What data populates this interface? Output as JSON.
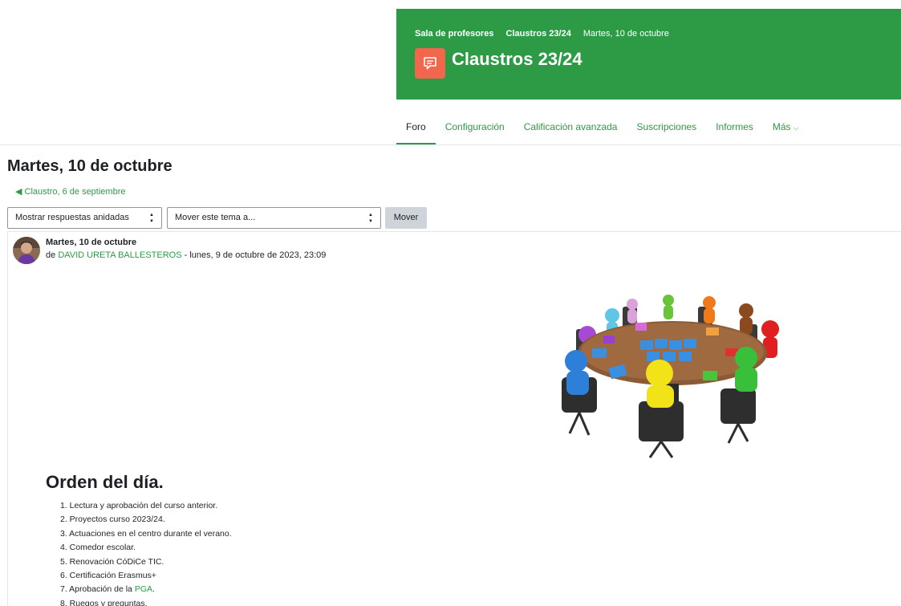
{
  "header": {
    "breadcrumbs": [
      "Sala de profesores",
      "Claustros 23/24",
      "Martes, 10 de octubre"
    ],
    "title": "Claustros 23/24",
    "icon": "forum-icon",
    "accent_color": "#2d9a46",
    "icon_color": "#f0674d"
  },
  "tabs": [
    {
      "label": "Foro",
      "active": true
    },
    {
      "label": "Configuración",
      "active": false
    },
    {
      "label": "Calificación avanzada",
      "active": false
    },
    {
      "label": "Suscripciones",
      "active": false
    },
    {
      "label": "Informes",
      "active": false
    },
    {
      "label": "Más",
      "active": false
    }
  ],
  "discussion": {
    "title": "Martes, 10 de octubre",
    "prev_link": "Claustro, 6 de septiembre",
    "display_mode": "Mostrar respuestas anidadas",
    "move_placeholder": "Mover este tema a...",
    "move_button": "Mover"
  },
  "post": {
    "subject": "Martes, 10 de octubre",
    "by_prefix": "de",
    "author": "DAVID URETA BALLESTEROS",
    "date": " - lunes, 9 de octubre de 2023, 23:09",
    "heading": "Orden del día.",
    "agenda": [
      "1. Lectura y aprobación del curso anterior.",
      "2. Proyectos curso 2023/24.",
      "3. Actuaciones en el centro durante el verano.",
      "4. Comedor escolar.",
      "5. Renovación CóDiCe TIC.",
      "6. Certificación Erasmus+",
      "7. Aprobación de la ",
      "8. Ruegos y preguntas."
    ],
    "agenda_link": "PGA",
    "agenda_link_suffix": "."
  }
}
